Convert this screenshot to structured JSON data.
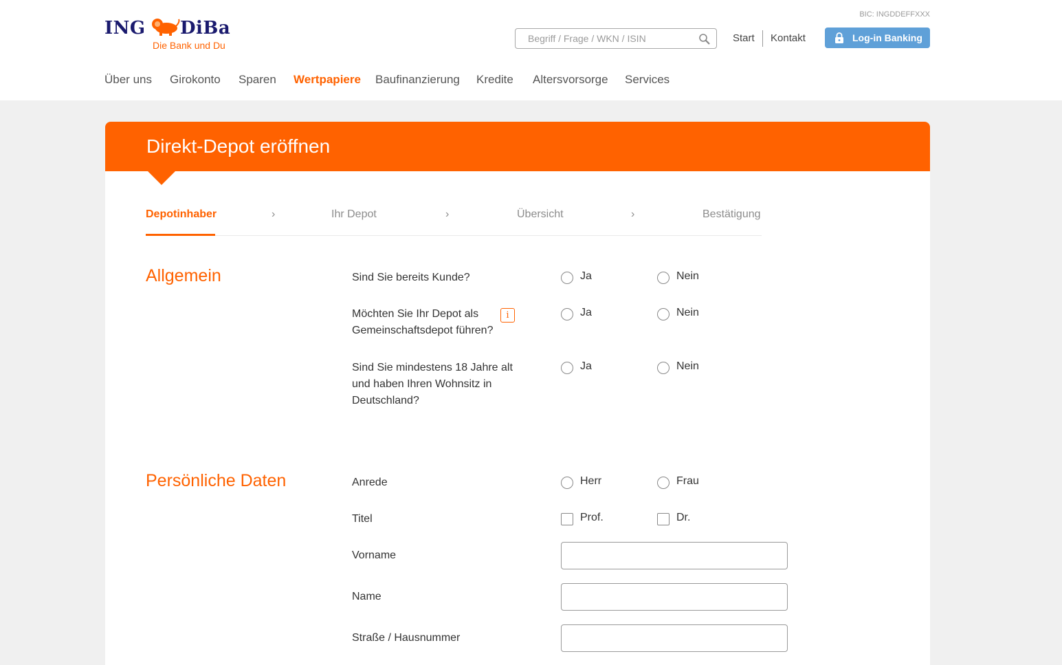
{
  "header": {
    "logo": {
      "brand_left": "ING",
      "brand_right": "DiBa",
      "tagline": "Die Bank und Du"
    },
    "bic": "BIC: INGDDEFFXXX",
    "search": {
      "placeholder": "Begriff / Frage / WKN / ISIN",
      "value": ""
    },
    "links": {
      "start": "Start",
      "kontakt": "Kontakt"
    },
    "login_label": "Log-in Banking"
  },
  "nav": {
    "items": [
      "Über uns",
      "Girokonto",
      "Sparen",
      "Wertpapiere",
      "Baufinanzierung",
      "Kredite",
      "Altersvorsorge",
      "Services"
    ],
    "active": "Wertpapiere"
  },
  "page": {
    "title": "Direkt-Depot eröffnen",
    "steps": [
      "Depotinhaber",
      "Ihr Depot",
      "Übersicht",
      "Bestätigung"
    ],
    "active_step": "Depotinhaber",
    "chevron": "›"
  },
  "allgemein": {
    "title": "Allgemein",
    "questions": [
      {
        "text": "Sind Sie bereits Kunde?",
        "yes": "Ja",
        "no": "Nein"
      },
      {
        "text": "Möchten Sie Ihr Depot als Gemeinschaftsdepot führen?",
        "yes": "Ja",
        "no": "Nein",
        "info": "i"
      },
      {
        "text": "Sind Sie mindestens 18 Jahre alt und haben Ihren Wohnsitz in Deutschland?",
        "yes": "Ja",
        "no": "Nein"
      }
    ]
  },
  "personal": {
    "title": "Persönliche Daten",
    "anrede": {
      "label": "Anrede",
      "options": [
        "Herr",
        "Frau"
      ]
    },
    "titel": {
      "label": "Titel",
      "options": [
        "Prof.",
        "Dr."
      ]
    },
    "fields": [
      {
        "label": "Vorname",
        "value": ""
      },
      {
        "label": "Name",
        "value": ""
      },
      {
        "label": "Straße / Hausnummer",
        "value": ""
      }
    ]
  },
  "colors": {
    "brand_orange": "#ff6200",
    "login_blue": "#5fa0d8",
    "logo_navy": "#1a1a6e"
  },
  "icons": [
    "lion-logo-icon",
    "search-icon",
    "lock-icon",
    "info-icon"
  ]
}
